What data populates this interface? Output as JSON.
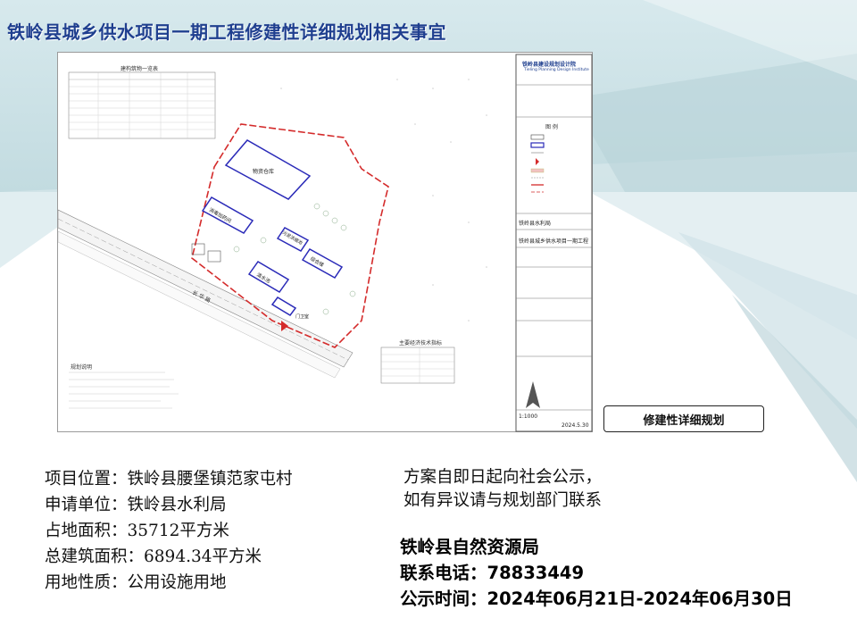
{
  "page": {
    "title": "铁岭县城乡供水项目一期工程修建性详细规划相关事宜"
  },
  "plan": {
    "label": "修建性详细规划",
    "table_title": "建构筑物一览表",
    "tech_title": "主要经济技术指标",
    "notes_title": "规划说明",
    "institute_name": "铁岭县建设规划设计院",
    "institute_en": "Tieling Planning Design Institute",
    "legend_title": "图 例",
    "client": "铁岭县水利局",
    "project": "铁岭县城乡供水项目一期工程",
    "buildings": [
      "物资仓库",
      "消毒加药间",
      "综合楼",
      "清水池",
      "门卫室",
      "污泥浓缩池"
    ],
    "road": "长 华 路",
    "scale": "1:1000",
    "date": "2024.5.30"
  },
  "info": [
    {
      "key": "项目位置：",
      "value": "铁岭县腰堡镇范家屯村"
    },
    {
      "key": "申请单位：",
      "value": "铁岭县水利局"
    },
    {
      "key": "占地面积：",
      "value": "35712平方米"
    },
    {
      "key": "总建筑面积：",
      "value": "6894.34平方米"
    },
    {
      "key": "用地性质：",
      "value": "公用设施用地"
    }
  ],
  "notice": {
    "line1": "方案自即日起向社会公示，",
    "line2": "如有异议请与规划部门联系"
  },
  "org": {
    "name": "铁岭县自然资源局",
    "phone_label": "联系电话：",
    "phone": "78833449",
    "period_label": "公示时间：",
    "period": "2024年06月21日-2024年06月30日"
  },
  "colors": {
    "title": "#1f3f8f",
    "teal_band": "#c9dfe4",
    "boundary": "#d42b2b",
    "building": "#2a2ab8"
  }
}
